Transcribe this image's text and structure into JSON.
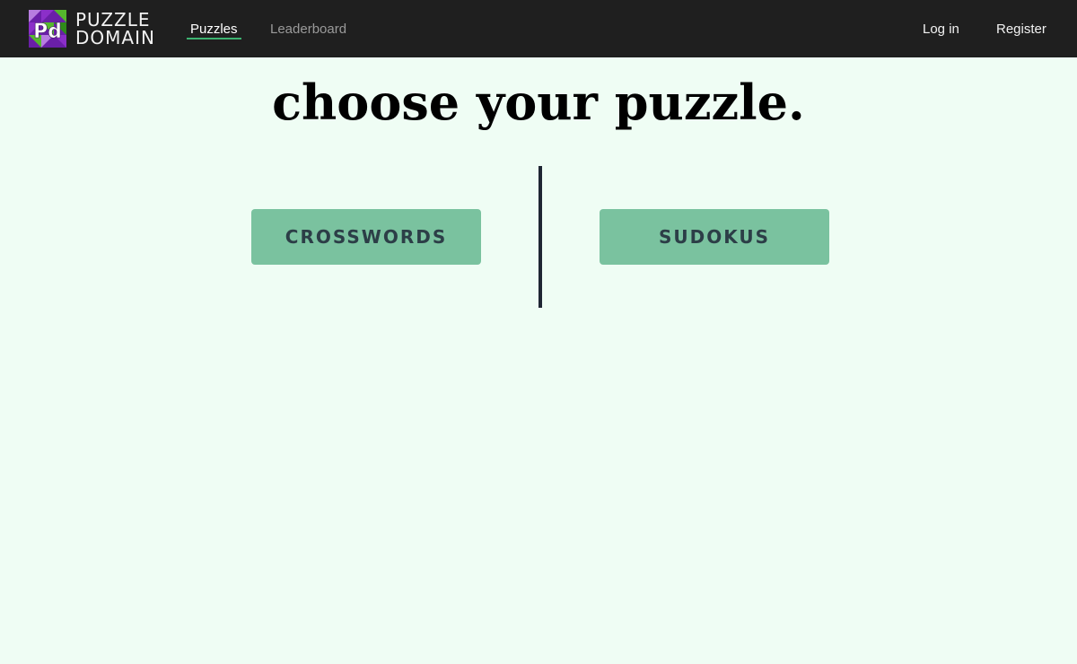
{
  "brand": {
    "line1": "PUZZLE",
    "line2": "DOMAIN",
    "mark_letters": "Pd",
    "colors": [
      "#8b2fc9",
      "#6a1fa8",
      "#55b82d",
      "#2f8a1a",
      "#b77de0"
    ]
  },
  "nav": {
    "left": [
      {
        "label": "Puzzles",
        "active": true
      },
      {
        "label": "Leaderboard",
        "active": false
      }
    ],
    "right": [
      {
        "label": "Log in"
      },
      {
        "label": "Register"
      }
    ],
    "active_indicator_color": "#3cb371",
    "background": "#1f1f1f"
  },
  "main": {
    "headline": "choose your puzzle.",
    "choices": [
      {
        "label": "CROSSWORDS"
      },
      {
        "label": "SUDOKUS"
      }
    ],
    "button_color": "#7ac29f",
    "button_text_color": "#2c3e47",
    "page_background": "#effdf4"
  }
}
